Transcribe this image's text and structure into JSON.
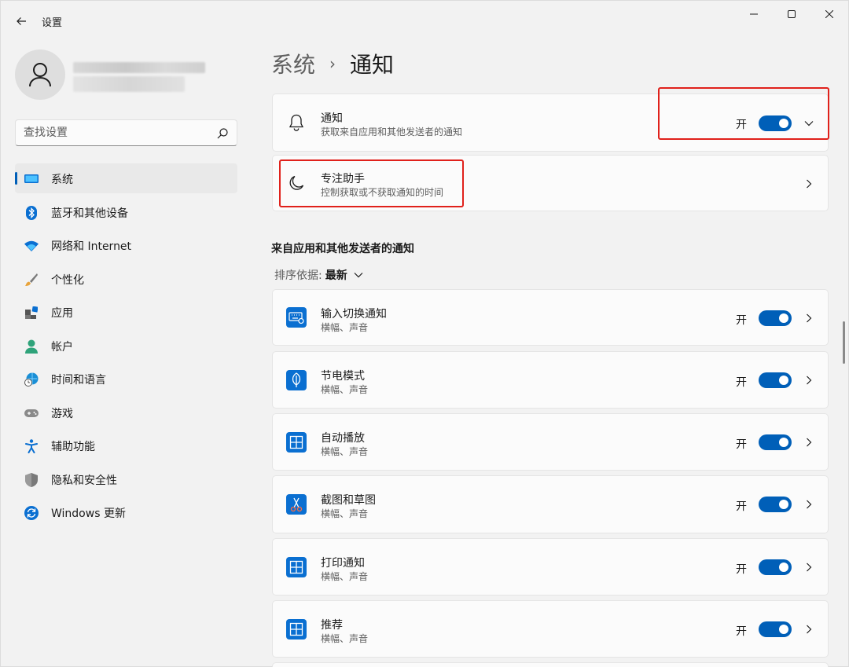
{
  "window": {
    "title": "设置",
    "minimize_icon": "minimize-icon",
    "maximize_icon": "maximize-icon",
    "close_icon": "close-icon"
  },
  "search": {
    "placeholder": "查找设置"
  },
  "sidebar": {
    "items": [
      {
        "label": "系统",
        "icon": "monitor-icon",
        "active": true
      },
      {
        "label": "蓝牙和其他设备",
        "icon": "bluetooth-icon"
      },
      {
        "label": "网络和 Internet",
        "icon": "wifi-icon"
      },
      {
        "label": "个性化",
        "icon": "brush-icon"
      },
      {
        "label": "应用",
        "icon": "apps-icon"
      },
      {
        "label": "帐户",
        "icon": "person-icon"
      },
      {
        "label": "时间和语言",
        "icon": "globe-clock-icon"
      },
      {
        "label": "游戏",
        "icon": "gamepad-icon"
      },
      {
        "label": "辅助功能",
        "icon": "accessibility-icon"
      },
      {
        "label": "隐私和安全性",
        "icon": "shield-icon"
      },
      {
        "label": "Windows 更新",
        "icon": "update-icon"
      }
    ]
  },
  "breadcrumb": {
    "parent": "系统",
    "separator": "›",
    "current": "通知"
  },
  "notifications_card": {
    "title": "通知",
    "subtitle": "获取来自应用和其他发送者的通知",
    "state": "开",
    "enabled": true,
    "icon": "bell-icon"
  },
  "focus_card": {
    "title": "专注助手",
    "subtitle": "控制获取或不获取通知的时间",
    "icon": "moon-icon"
  },
  "apps_section": {
    "title": "来自应用和其他发送者的通知",
    "sort_label": "排序依据:",
    "sort_value": "最新"
  },
  "apps": [
    {
      "title": "输入切换通知",
      "subtitle": "横幅、声音",
      "state": "开",
      "enabled": true,
      "icon": "keyboard-settings-icon"
    },
    {
      "title": "节电模式",
      "subtitle": "横幅、声音",
      "state": "开",
      "enabled": true,
      "icon": "leaf-icon"
    },
    {
      "title": "自动播放",
      "subtitle": "横幅、声音",
      "state": "开",
      "enabled": true,
      "icon": "app-grid-icon"
    },
    {
      "title": "截图和草图",
      "subtitle": "横幅、声音",
      "state": "开",
      "enabled": true,
      "icon": "snip-icon"
    },
    {
      "title": "打印通知",
      "subtitle": "横幅、声音",
      "state": "开",
      "enabled": true,
      "icon": "app-grid-icon"
    },
    {
      "title": "推荐",
      "subtitle": "横幅、声音",
      "state": "开",
      "enabled": true,
      "icon": "app-grid-icon"
    }
  ],
  "colors": {
    "accent": "#005fb8",
    "highlight_box": "#e0211b",
    "app_icon_bg": "#0a6fd1"
  }
}
